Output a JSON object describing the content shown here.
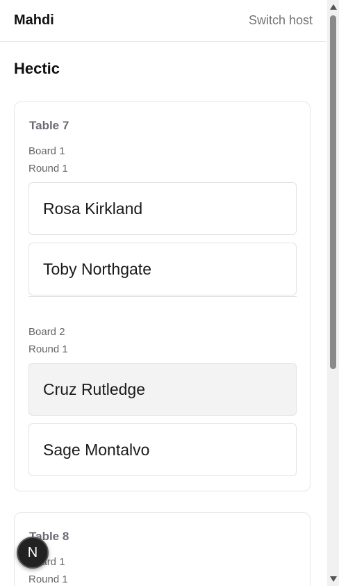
{
  "header": {
    "brand": "Mahdi",
    "switch_host_label": "Switch host"
  },
  "section": {
    "title": "Hectic"
  },
  "tables": [
    {
      "title": "Table 7",
      "boards": [
        {
          "board": "Board 1",
          "round": "Round 1",
          "players": [
            "Rosa Kirkland",
            "Toby Northgate"
          ]
        },
        {
          "board": "Board 2",
          "round": "Round 1",
          "players": [
            "Cruz Rutledge",
            "Sage Montalvo"
          ]
        }
      ]
    },
    {
      "title": "Table 8",
      "boards": [
        {
          "board": "Board 1",
          "round": "Round 1"
        }
      ]
    }
  ],
  "fab": {
    "icon": "next-logo-icon",
    "label": "N"
  }
}
